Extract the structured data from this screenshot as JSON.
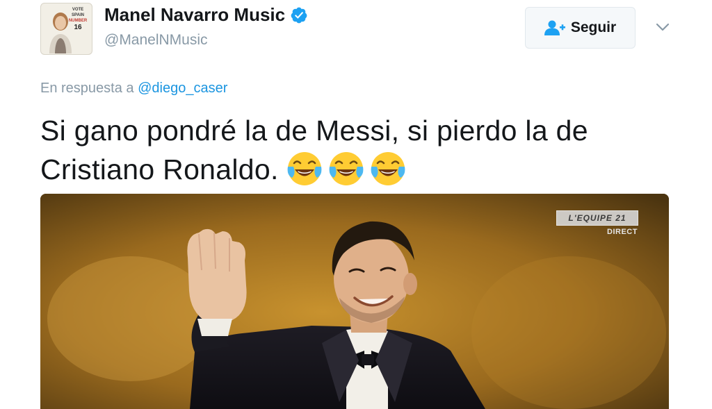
{
  "user": {
    "display_name": "Manel Navarro Music",
    "handle": "@ManelNMusic",
    "verified": true,
    "avatar_poster": {
      "line1": "VOTE SPAIN",
      "line2": "NUMBER",
      "number": "16"
    }
  },
  "actions": {
    "follow_label": "Seguir",
    "follow_icon": "add-user-icon",
    "more_icon": "chevron-down-icon"
  },
  "reply": {
    "prefix": "En respuesta a",
    "mention": "@diego_caser"
  },
  "tweet": {
    "text": "Si gano pondré la de Messi, si pierdo la de Cristiano Ronaldo.",
    "emojis": [
      "face-with-tears-of-joy",
      "face-with-tears-of-joy",
      "face-with-tears-of-joy"
    ]
  },
  "media": {
    "broadcaster_logo": "L'EQUIPE 21",
    "live_label": "DIRECT"
  },
  "colors": {
    "link": "#1b95e0",
    "muted": "#8899a6",
    "verified": "#1da1f2",
    "text": "#14171a"
  }
}
